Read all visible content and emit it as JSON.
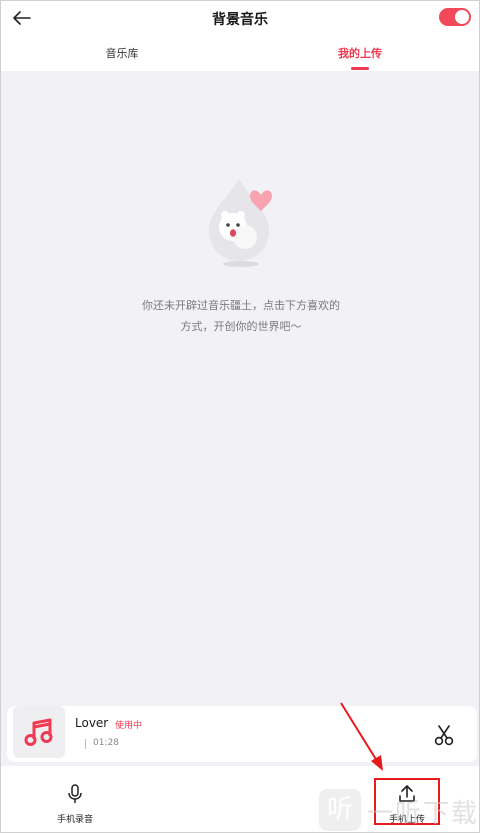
{
  "header": {
    "title": "背景音乐",
    "toggle_on": true
  },
  "tabs": [
    {
      "label": "音乐库",
      "active": false
    },
    {
      "label": "我的上传",
      "active": true
    }
  ],
  "empty_state": {
    "line1": "你还未开辟过音乐疆土，点击下方喜欢的",
    "line2": "方式，开创你的世界吧～"
  },
  "current_song": {
    "title": "Lover",
    "status": "使用中",
    "duration": "01:28"
  },
  "bottom_actions": [
    {
      "label": "手机录音",
      "icon": "microphone-icon"
    },
    {
      "label": "手机上传",
      "icon": "upload-icon"
    }
  ],
  "watermark": {
    "logo": "听",
    "text": "一听下载"
  },
  "colors": {
    "accent": "#f03a52",
    "content_bg": "#f2f2f6",
    "annotation_red": "#e8191c"
  }
}
